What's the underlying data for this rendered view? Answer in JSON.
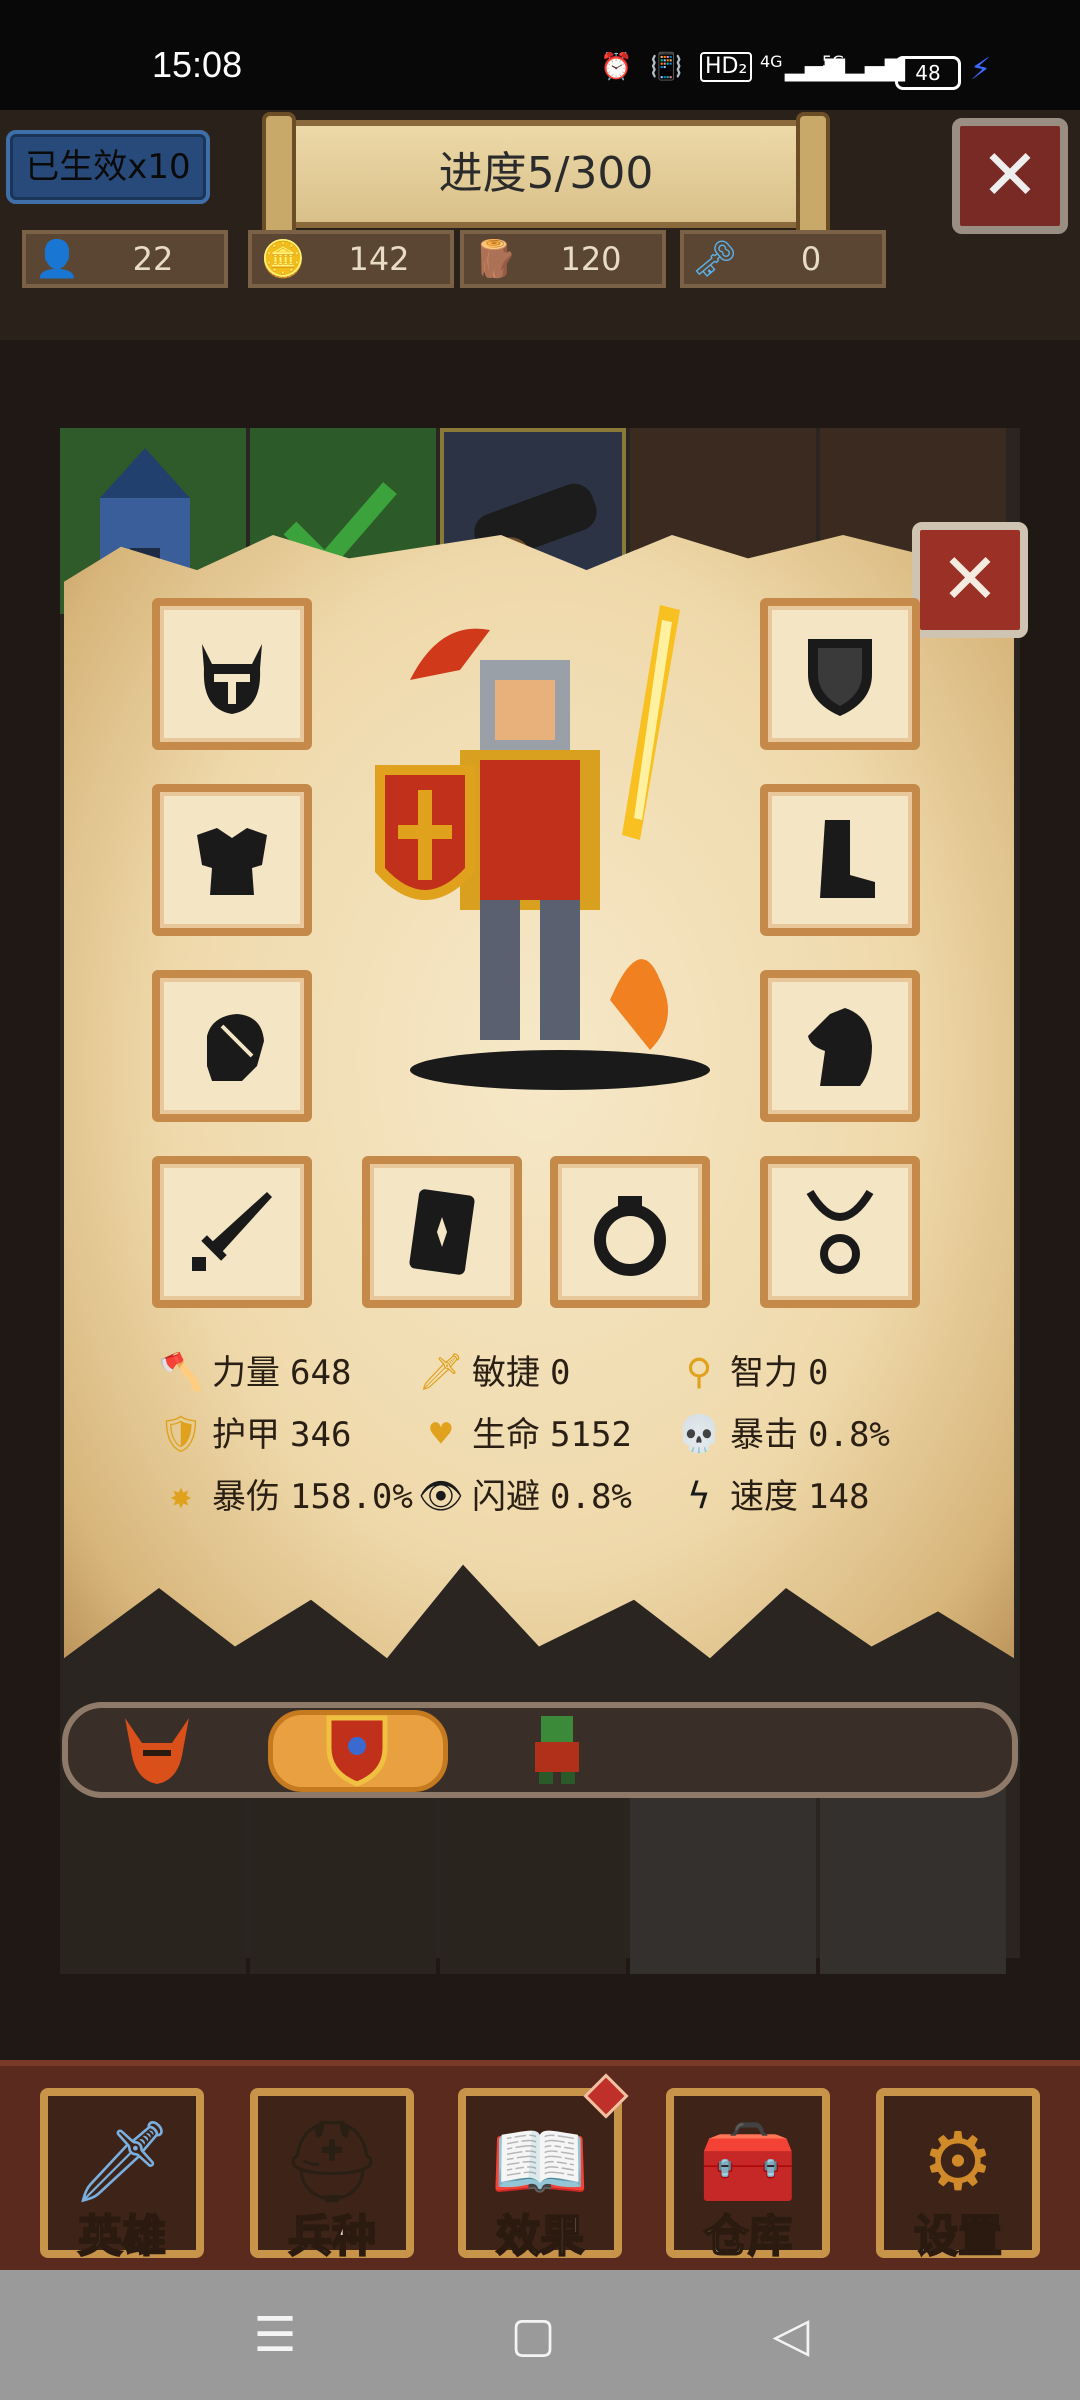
{
  "status_bar": {
    "time": "15:08",
    "network_labels": [
      "HD₂",
      "4G",
      "5G"
    ],
    "battery": "48"
  },
  "header": {
    "lives_badge": "已生效x10",
    "progress": "进度5/300",
    "close_icon": "close-icon"
  },
  "resources": [
    {
      "icon": "population-icon",
      "value": "22"
    },
    {
      "icon": "gold-coins-icon",
      "value": "142"
    },
    {
      "icon": "wood-logs-icon",
      "value": "120"
    },
    {
      "icon": "magic-key-icon",
      "value": "0"
    }
  ],
  "equipment_slots": [
    {
      "name": "helmet-slot",
      "icon": "helmet-icon"
    },
    {
      "name": "shield-slot",
      "icon": "shield-icon"
    },
    {
      "name": "armor-slot",
      "icon": "chest-armor-icon"
    },
    {
      "name": "boots-slot",
      "icon": "boots-icon"
    },
    {
      "name": "gloves-slot",
      "icon": "gauntlet-icon"
    },
    {
      "name": "mount-slot",
      "icon": "horse-icon"
    },
    {
      "name": "weapon-slot",
      "icon": "sword-icon"
    },
    {
      "name": "card-slot",
      "icon": "card-icon"
    },
    {
      "name": "ring-slot",
      "icon": "ring-icon"
    },
    {
      "name": "necklace-slot",
      "icon": "necklace-icon"
    }
  ],
  "stats": [
    {
      "icon": "axe-icon",
      "label": "力量",
      "value": "648"
    },
    {
      "icon": "dagger-icon",
      "label": "敏捷",
      "value": "0"
    },
    {
      "icon": "staff-icon",
      "label": "智力",
      "value": "0"
    },
    {
      "icon": "shield-stat-icon",
      "label": "护甲",
      "value": "346"
    },
    {
      "icon": "heart-icon",
      "label": "生命",
      "value": "5152"
    },
    {
      "icon": "skull-icon",
      "label": "暴击",
      "value": "0.8%"
    },
    {
      "icon": "burst-icon",
      "label": "暴伤",
      "value": "158.0%"
    },
    {
      "icon": "eye-icon",
      "label": "闪避",
      "value": "0.8%"
    },
    {
      "icon": "lightning-icon",
      "label": "速度",
      "value": "148"
    }
  ],
  "hero_tabs": [
    {
      "icon": "horned-helmet-hero-icon",
      "selected": false
    },
    {
      "icon": "shield-hero-icon",
      "selected": true
    },
    {
      "icon": "orc-hero-icon",
      "selected": false
    }
  ],
  "bottom_nav": [
    {
      "label": "英雄",
      "icon": "sword-icon"
    },
    {
      "label": "兵种",
      "icon": "knight-helmet-icon"
    },
    {
      "label": "效果",
      "icon": "spellbook-icon",
      "badge": true
    },
    {
      "label": "仓库",
      "icon": "treasure-chest-icon"
    },
    {
      "label": "设置",
      "icon": "gear-icon"
    }
  ],
  "system_nav": [
    "menu-icon",
    "home-icon",
    "back-icon"
  ],
  "colors": {
    "parchment": "#efd9ab",
    "slot_border": "#c58a4a",
    "close_red": "#9a3026",
    "accent_orange": "#e8a040"
  }
}
